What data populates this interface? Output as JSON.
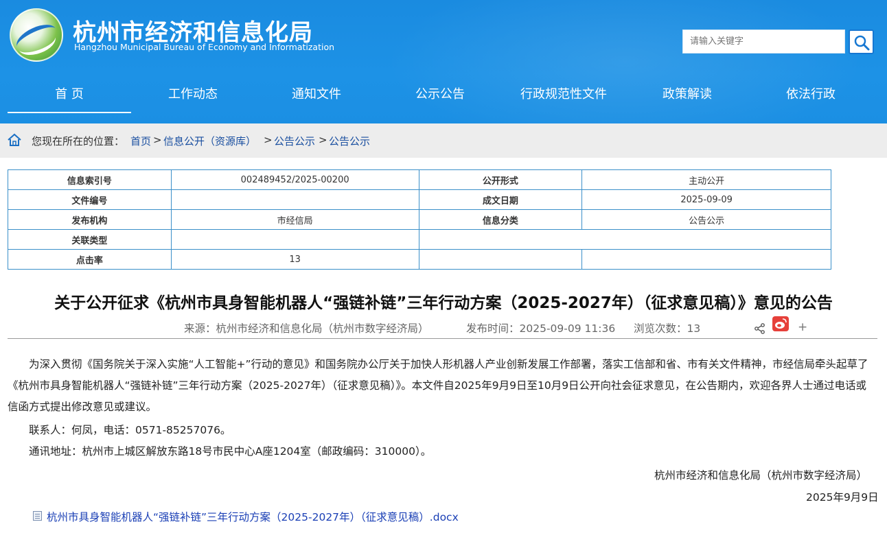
{
  "header": {
    "title": "杭州市经济和信息化局",
    "subtitle": "Hangzhou Municipal Bureau of Economy and Informatization",
    "search_placeholder": "请输入关键字"
  },
  "nav": {
    "items": [
      "首 页",
      "工作动态",
      "通知文件",
      "公示公告",
      "行政规范性文件",
      "政策解读",
      "依法行政"
    ],
    "active": "首 页"
  },
  "breadcrumb": {
    "prefix": "您现在所在的位置：",
    "items": [
      "首页",
      "信息公开（资源库）",
      "公告公示",
      "公告公示"
    ],
    "separator": ">"
  },
  "info_table": {
    "rows": [
      [
        "信息索引号",
        "002489452/2025-00200",
        "公开形式",
        "主动公开"
      ],
      [
        "文件编号",
        "",
        "成文日期",
        "2025-09-09"
      ],
      [
        "发布机构",
        "市经信局",
        "信息分类",
        "公告公示"
      ],
      [
        "关联类型",
        "",
        "",
        ""
      ],
      [
        "点击率",
        "13",
        "",
        ""
      ]
    ]
  },
  "article": {
    "title": "关于公开征求《杭州市具身智能机器人“强链补链”三年行动方案（2025-2027年）（征求意见稿）》意见的公告",
    "source": "来源：杭州市经济和信息化局（杭州市数字经济局）",
    "publish_time": "发布时间：2025-09-09 11:36",
    "views": "浏览次数：13",
    "plus": "+",
    "body": [
      "为深入贯彻《国务院关于深入实施“人工智能+”行动的意见》和国务院办公厅关于加快人形机器人产业创新发展工作部署，落实工信部和省、市有关文件精神，市经信局牵头起草了《杭州市具身智能机器人“强链补链”三年行动方案（2025-2027年）（征求意见稿）》。本文件自2025年9月9日至10月9日公开向社会征求意见，在公告期内，欢迎各界人士通过电话或信函方式提出修改意见或建议。",
      "联系人：何凤，电话：0571-85257076。",
      "通讯地址：杭州市上城区解放东路18号市民中心A座1204室（邮政编码：310000）。"
    ],
    "signature": "杭州市经济和信息化局（杭州市数字经济局）",
    "date": "2025年9月9日",
    "attachment": "杭州市具身智能机器人“强链补链”三年行动方案（2025-2027年）（征求意见稿）.docx"
  }
}
